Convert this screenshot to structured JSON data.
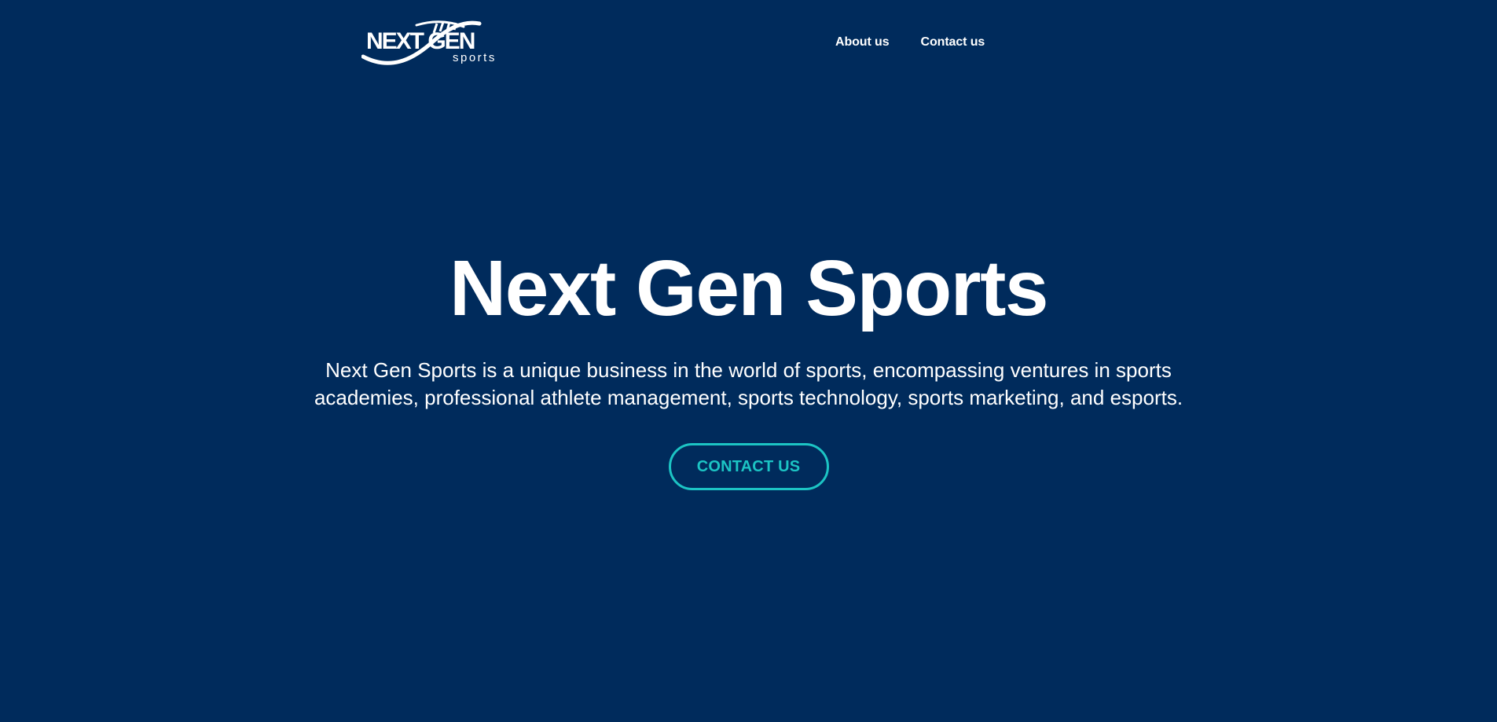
{
  "brand": {
    "logo_word_1": "NEXT GEN",
    "logo_word_2": "sports",
    "background_color": "#002b5c",
    "accent_color": "#1cc4c4"
  },
  "nav": {
    "items": [
      {
        "label": "About us"
      },
      {
        "label": "Contact us"
      }
    ]
  },
  "hero": {
    "title": "Next Gen Sports",
    "description": "Next Gen Sports is a unique business in the world of sports, encompassing ventures in sports academies, professional athlete management, sports technology, sports marketing, and esports.",
    "cta_label": "CONTACT US"
  }
}
